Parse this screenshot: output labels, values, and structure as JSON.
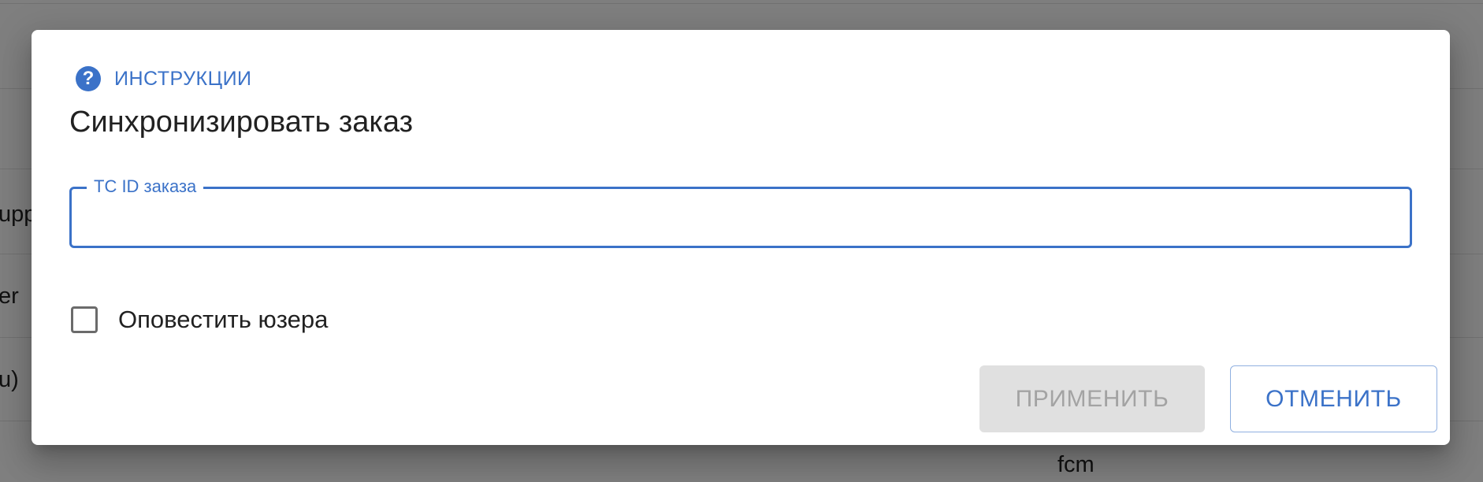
{
  "background": {
    "fragments": [
      "upp",
      "er",
      "u)",
      "fcm"
    ]
  },
  "dialog": {
    "instructions": {
      "icon": "help-circle-icon",
      "icon_glyph": "?",
      "label": "ИНСТРУКЦИИ"
    },
    "title": "Синхронизировать заказ",
    "order_field": {
      "label": "TC ID заказа",
      "value": "",
      "focused": true
    },
    "notify_checkbox": {
      "label": "Оповестить юзера",
      "checked": false
    },
    "actions": {
      "apply_label": "ПРИМЕНИТЬ",
      "apply_disabled": true,
      "cancel_label": "ОТМЕНИТЬ"
    }
  },
  "colors": {
    "accent": "#3b72c8",
    "disabled_bg": "#e0e0e0",
    "disabled_text": "#a3a3a3",
    "backdrop": "rgba(0,0,0,0.5)"
  }
}
